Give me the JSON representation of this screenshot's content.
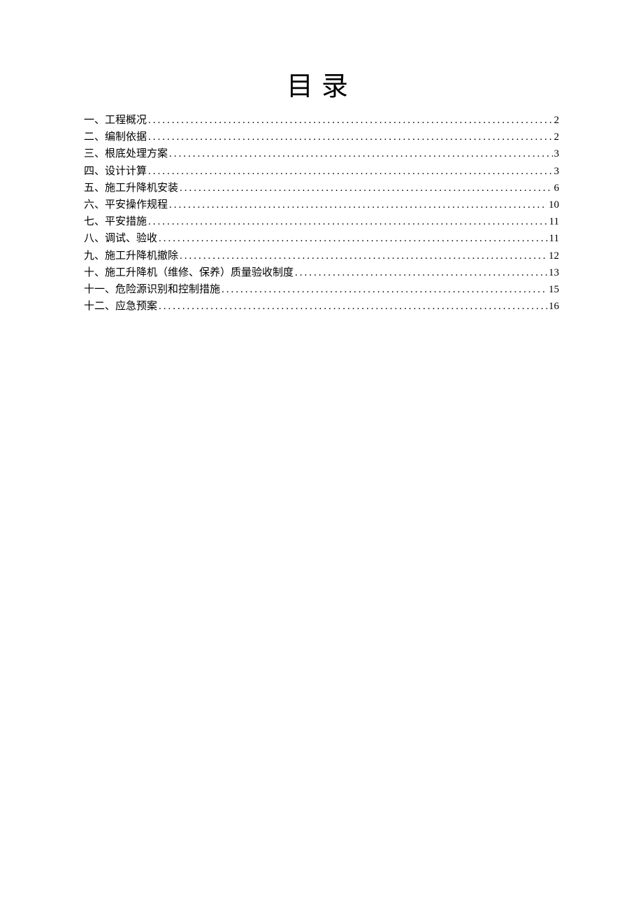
{
  "title": "目录",
  "toc": [
    {
      "label": "一、工程概况",
      "page": "2"
    },
    {
      "label": "二、编制依据",
      "page": "2"
    },
    {
      "label": "三、根底处理方案",
      "page": "3"
    },
    {
      "label": "四、设计计算",
      "page": "3"
    },
    {
      "label": "五、施工升降机安装",
      "page": "6"
    },
    {
      "label": "六、平安操作规程",
      "page": "10"
    },
    {
      "label": "七、平安措施",
      "page": "11"
    },
    {
      "label": "八、调试、验收",
      "page": "11"
    },
    {
      "label": "九、施工升降机撤除",
      "page": "12"
    },
    {
      "label": "十、施工升降机（维修、保养）质量验收制度",
      "page": "13"
    },
    {
      "label": "十一、危险源识别和控制措施",
      "page": "15"
    },
    {
      "label": "十二、应急预案",
      "page": "16"
    }
  ]
}
